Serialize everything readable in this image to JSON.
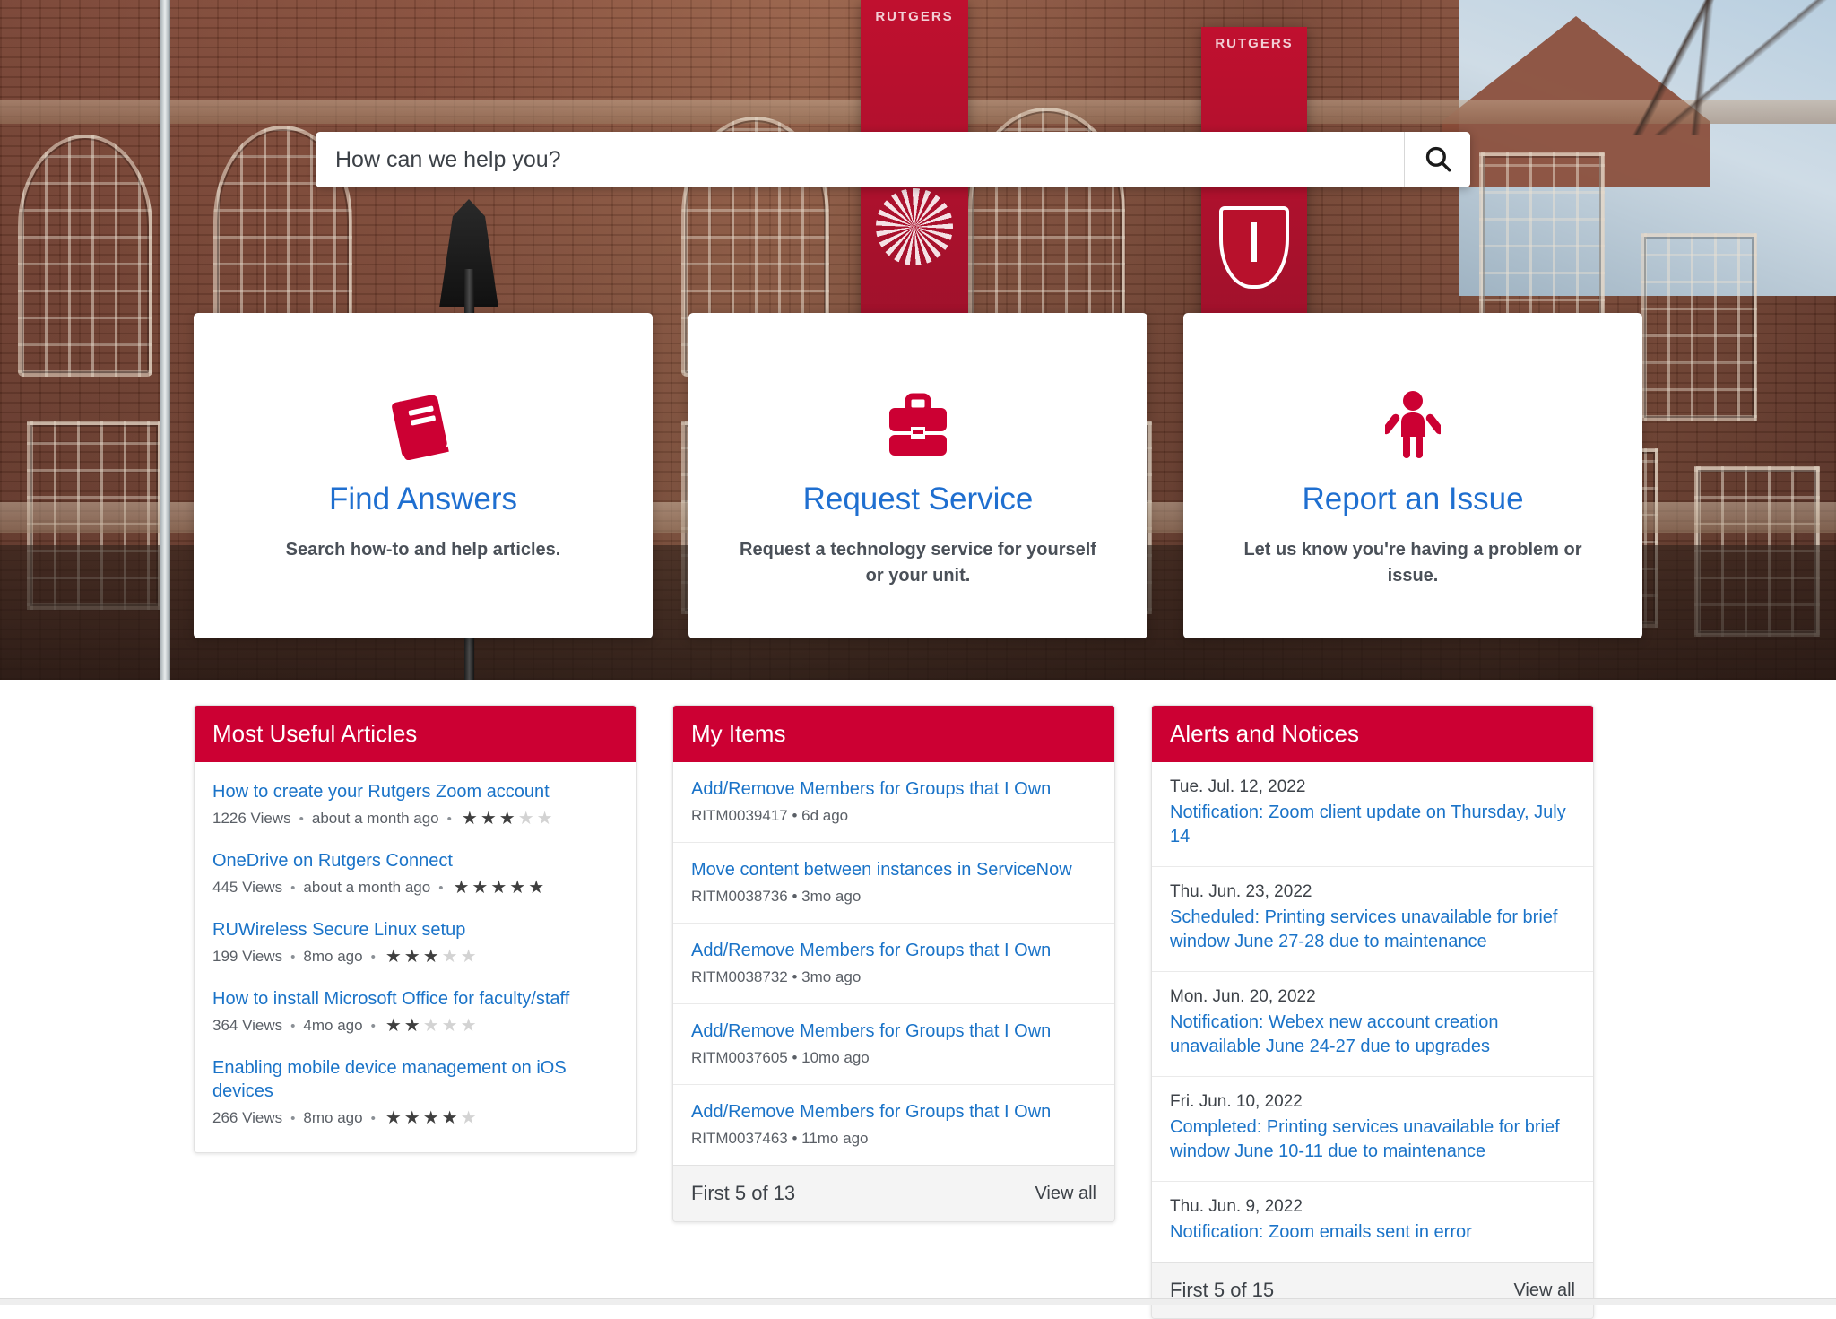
{
  "search": {
    "placeholder": "How can we help you?",
    "value": "",
    "button_icon": "search-icon"
  },
  "cards": [
    {
      "icon": "book-icon",
      "title": "Find Answers",
      "desc": "Search how-to and help articles."
    },
    {
      "icon": "briefcase-icon",
      "title": "Request Service",
      "desc": "Request a technology service for yourself or your unit."
    },
    {
      "icon": "person-raising-arms-icon",
      "title": "Report an Issue",
      "desc": "Let us know you're having a problem or issue."
    }
  ],
  "colors": {
    "brand_crimson": "#cc0033",
    "link_blue": "#1a73c8",
    "card_title_blue": "#1f6fd0",
    "meta_gray": "#5a5f66",
    "star_on": "#3f3f3f",
    "star_off": "#d3d3d3"
  },
  "articles_panel": {
    "title": "Most Useful Articles",
    "items": [
      {
        "title": "How to create your Rutgers Zoom account",
        "views": "1226 Views",
        "age": "about a month ago",
        "rating": 3
      },
      {
        "title": "OneDrive on Rutgers Connect",
        "views": "445 Views",
        "age": "about a month ago",
        "rating": 5
      },
      {
        "title": "RUWireless Secure Linux setup",
        "views": "199 Views",
        "age": "8mo ago",
        "rating": 3
      },
      {
        "title": "How to install Microsoft Office for faculty/staff",
        "views": "364 Views",
        "age": "4mo ago",
        "rating": 2
      },
      {
        "title": "Enabling mobile device management on iOS devices",
        "views": "266 Views",
        "age": "8mo ago",
        "rating": 4
      }
    ]
  },
  "items_panel": {
    "title": "My Items",
    "items": [
      {
        "title": "Add/Remove Members for Groups that I Own",
        "meta": "RITM0039417 • 6d ago"
      },
      {
        "title": "Move content between instances in ServiceNow",
        "meta": "RITM0038736 • 3mo ago"
      },
      {
        "title": "Add/Remove Members for Groups that I Own",
        "meta": "RITM0038732 • 3mo ago"
      },
      {
        "title": "Add/Remove Members for Groups that I Own",
        "meta": "RITM0037605 • 10mo ago"
      },
      {
        "title": "Add/Remove Members for Groups that I Own",
        "meta": "RITM0037463 • 11mo ago"
      }
    ],
    "footer_count": "First 5 of 13",
    "footer_link": "View all"
  },
  "alerts_panel": {
    "title": "Alerts and Notices",
    "items": [
      {
        "date": "Tue. Jul. 12, 2022",
        "title": "Notification: Zoom client update on Thursday, July 14"
      },
      {
        "date": "Thu. Jun. 23, 2022",
        "title": "Scheduled: Printing services unavailable for brief window June 27-28 due to maintenance"
      },
      {
        "date": "Mon. Jun. 20, 2022",
        "title": "Notification: Webex new account creation unavailable June 24-27 due to upgrades"
      },
      {
        "date": "Fri. Jun. 10, 2022",
        "title": "Completed: Printing services unavailable for brief window June 10-11 due to maintenance"
      },
      {
        "date": "Thu. Jun. 9, 2022",
        "title": "Notification: Zoom emails sent in error"
      }
    ],
    "footer_count": "First 5 of 15",
    "footer_link": "View all"
  }
}
